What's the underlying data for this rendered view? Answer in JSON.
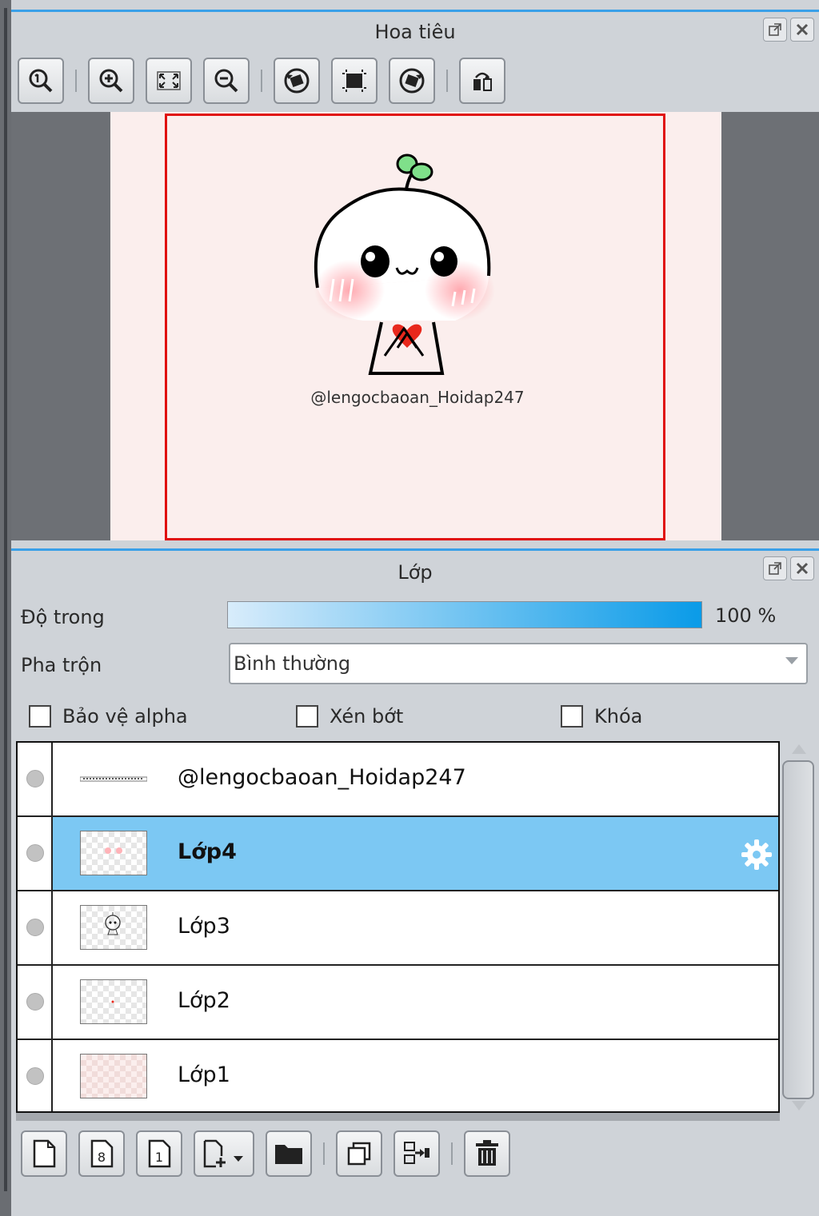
{
  "navigator": {
    "title": "Hoa tiêu",
    "watermark": "@lengocbaoan_Hoidap247",
    "toolbar_icons": [
      "zoom-actual-icon",
      "zoom-in-icon",
      "fit-screen-icon",
      "zoom-out-icon",
      "rotate-left-icon",
      "flip-icon",
      "rotate-right-icon",
      "mirror-icon"
    ]
  },
  "layers_panel": {
    "title": "Lớp",
    "opacity_label": "Độ trong",
    "opacity_value": "100 %",
    "opacity_percent": 100,
    "blend_label": "Pha trộn",
    "blend_value": "Bình thường",
    "protect_alpha": "Bảo vệ alpha",
    "clipping": "Xén bớt",
    "lock": "Khóa",
    "layers": [
      {
        "name": "@lengocbaoan_Hoidap247",
        "selected": false
      },
      {
        "name": "Lớp4",
        "selected": true
      },
      {
        "name": "Lớp3",
        "selected": false
      },
      {
        "name": "Lớp2",
        "selected": false
      },
      {
        "name": "Lớp1",
        "selected": false
      }
    ],
    "bottom_icons": [
      "new-layer-icon",
      "new-8bit-layer-icon",
      "new-1bit-layer-icon",
      "add-layer-dropdown-icon",
      "folder-icon",
      "duplicate-layer-icon",
      "merge-down-icon",
      "delete-layer-icon"
    ]
  },
  "colors": {
    "accent": "#3aa0e8",
    "selected_row": "#7cc8f3",
    "frame": "#e01010",
    "paper": "#fbeeed"
  }
}
